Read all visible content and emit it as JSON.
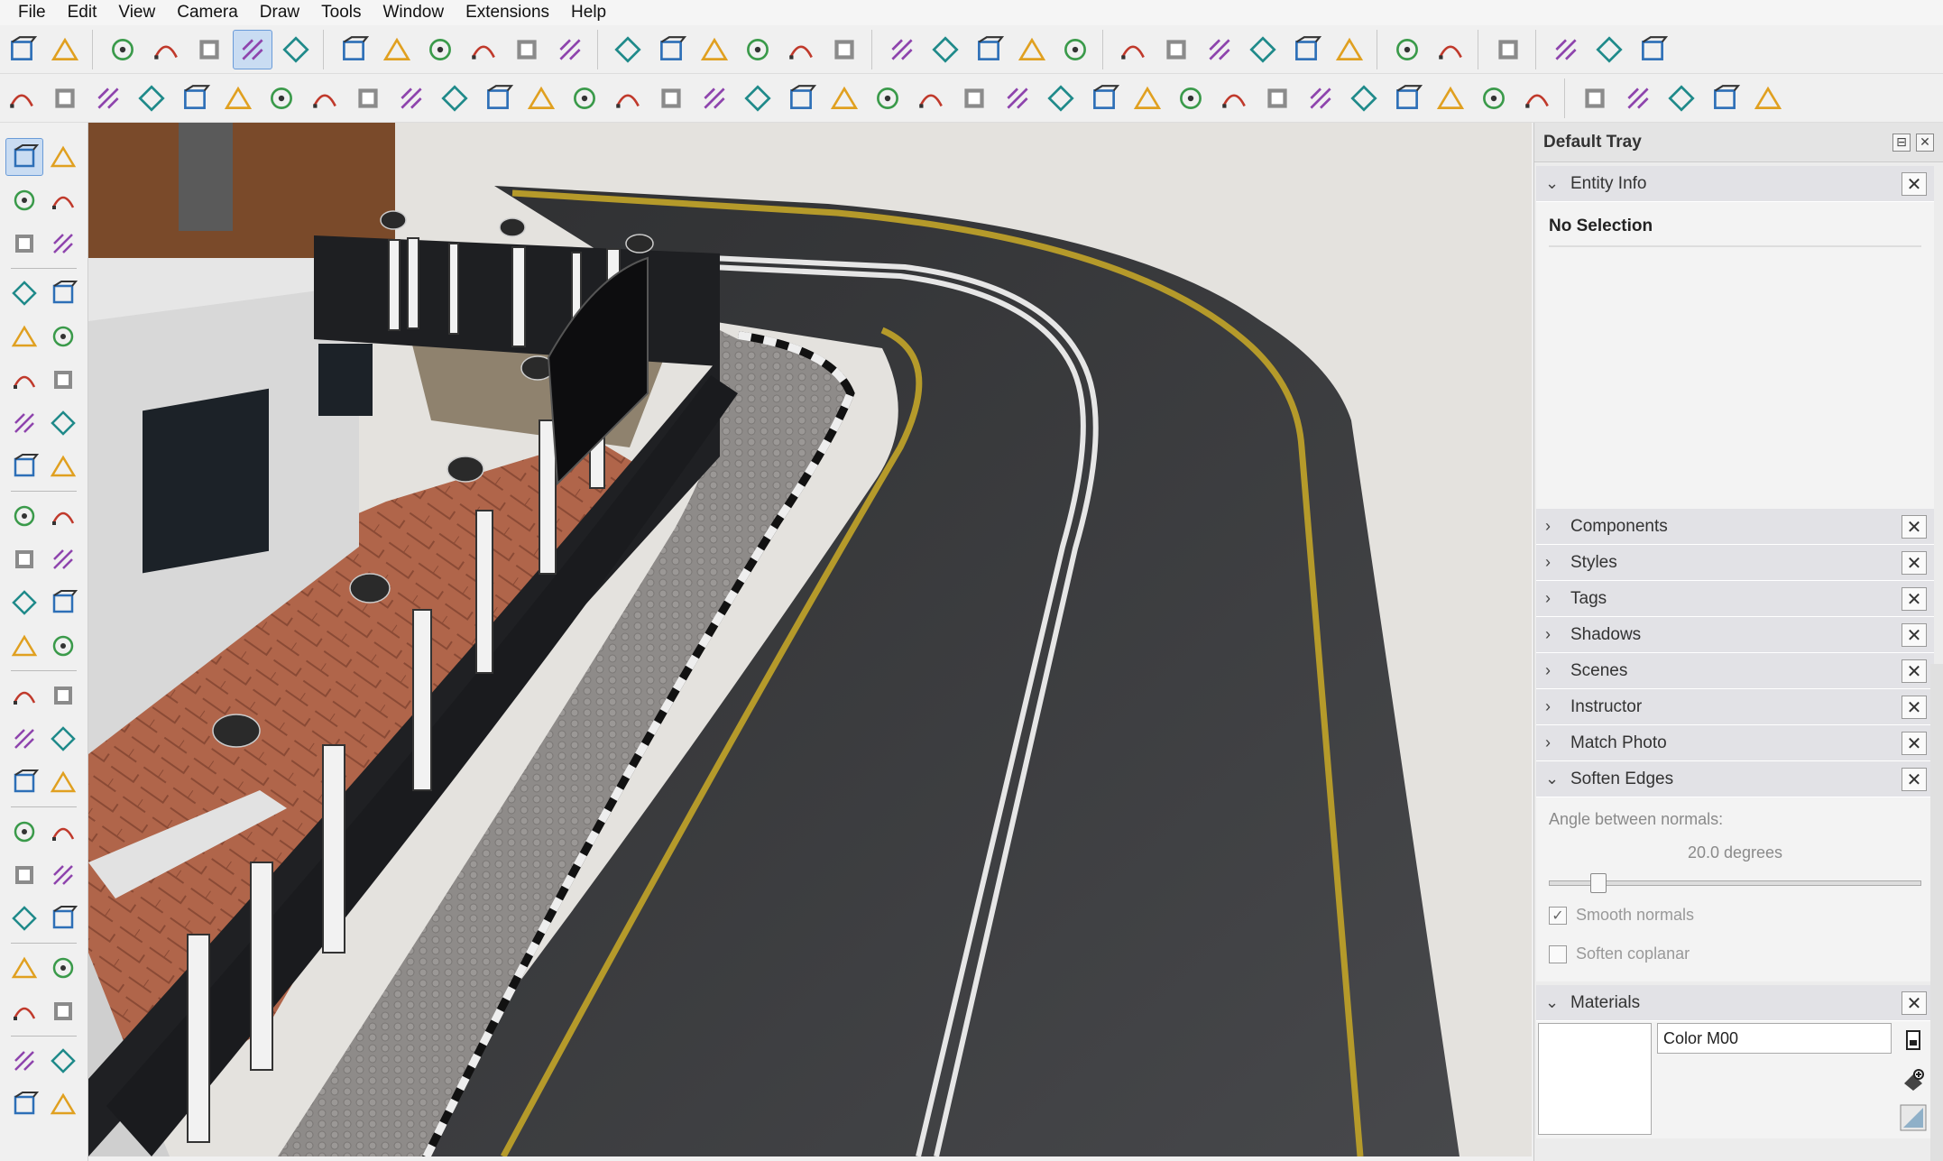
{
  "menu": [
    "File",
    "Edit",
    "View",
    "Camera",
    "Draw",
    "Tools",
    "Window",
    "Extensions",
    "Help"
  ],
  "toolbar1_icons": [
    "model-info-icon",
    "iso-view-icon",
    "xray-icon",
    "wireframe-icon",
    "shaded-icon",
    "shaded-textures-icon",
    "monochrome-icon",
    "top-view-icon",
    "front-view-icon",
    "right-view-icon",
    "back-view-icon",
    "left-view-icon",
    "bottom-view-icon",
    "section-plane-icon",
    "section-cut-icon",
    "section-fill-icon",
    "outer-shell-icon",
    "intersect-icon",
    "union-icon",
    "subtract-icon",
    "trim-icon",
    "split-icon",
    "sandbox-from-contours-icon",
    "sandbox-from-scratch-icon",
    "smoove-icon",
    "stamp-icon",
    "drape-icon",
    "add-detail-icon",
    "flip-edge-icon",
    "curviloft-icon",
    "geo-location-icon",
    "f6-extension-icon",
    "warehouse-icon",
    "section-1-icon",
    "section-2-icon",
    "section-3-icon"
  ],
  "toolbar2_icons": [
    "line-tools-icon",
    "bezier-icon",
    "freehand-icon",
    "cut-icon",
    "rotate-icon",
    "push-icon",
    "extrude-icon",
    "shape-bender-icon",
    "joint-push-pull-icon",
    "follow-me-icon",
    "fillet-icon",
    "chamfer-icon",
    "line-tool-icon",
    "curve-icon",
    "window-icon",
    "tri-icon",
    "stairs-icon",
    "columns-icon",
    "fence-icon",
    "wall-icon",
    "roof-icon",
    "truss-icon",
    "steps-icon",
    "rail-icon",
    "plank-icon",
    "beam-icon",
    "joist-icon",
    "grid-icon",
    "louver-icon",
    "deck-icon",
    "frame-icon",
    "stud-icon",
    "mesh-icon",
    "brace-icon",
    "lath-icon",
    "wrap-icon",
    "paint-1-icon",
    "paint-2-icon",
    "paint-3-icon",
    "paint-4-icon",
    "paint-5-icon"
  ],
  "left_tools": [
    [
      "select-icon",
      "lasso-select-icon"
    ],
    [
      "paint-bucket-icon",
      "eraser-icon"
    ],
    [
      "make-component-icon",
      "tag-icon"
    ],
    [
      "pencil-icon",
      "freehand-line-icon"
    ],
    [
      "rectangle-icon",
      "rotated-rectangle-icon"
    ],
    [
      "circle-icon",
      "polygon-icon"
    ],
    [
      "arc-icon",
      "two-point-arc-icon"
    ],
    [
      "three-point-arc-icon",
      "pie-icon"
    ],
    [
      "move-icon",
      "push-pull-icon"
    ],
    [
      "rotate-tool-icon",
      "follow-me-tool-icon"
    ],
    [
      "scale-icon",
      "offset-icon"
    ],
    [
      "solid-tools-icon",
      "flip-icon"
    ],
    [
      "tape-measure-icon",
      "dimension-icon"
    ],
    [
      "protractor-icon",
      "text-icon"
    ],
    [
      "axes-icon",
      "3d-text-icon"
    ],
    [
      "orbit-icon",
      "pan-icon"
    ],
    [
      "zoom-icon",
      "zoom-window-icon"
    ],
    [
      "zoom-extents-icon",
      "previous-view-icon"
    ],
    [
      "position-camera-icon",
      "walk-icon"
    ],
    [
      "look-around-icon",
      "section-plane-tool-icon"
    ],
    [
      "outliner-icon",
      "layers-icon"
    ],
    [
      "scenes-tool-icon",
      "settings-icon"
    ]
  ],
  "tray": {
    "title": "Default Tray",
    "entity_info": {
      "label": "Entity Info",
      "selection": "No Selection"
    },
    "panels_collapsed": [
      "Components",
      "Styles",
      "Tags",
      "Shadows",
      "Scenes",
      "Instructor",
      "Match Photo"
    ],
    "soften_edges": {
      "label": "Soften Edges",
      "angle_label": "Angle between normals:",
      "angle_value": "20.0  degrees",
      "angle_fraction": 0.11,
      "smooth_normals": {
        "label": "Smooth normals",
        "checked": true
      },
      "soften_coplanar": {
        "label": "Soften coplanar",
        "checked": false
      }
    },
    "materials": {
      "label": "Materials",
      "name": "Color M00"
    }
  },
  "colors": {
    "road": "#3b3c3e",
    "road_line_yellow": "#b59a2a",
    "road_line_white": "#e6e6e6",
    "wall": "#1f2023",
    "paving": "#b0654a",
    "sidewalk": "#8d8a88",
    "sky_ground": "#e2e0dc",
    "highlight": "#c9dcf2"
  }
}
